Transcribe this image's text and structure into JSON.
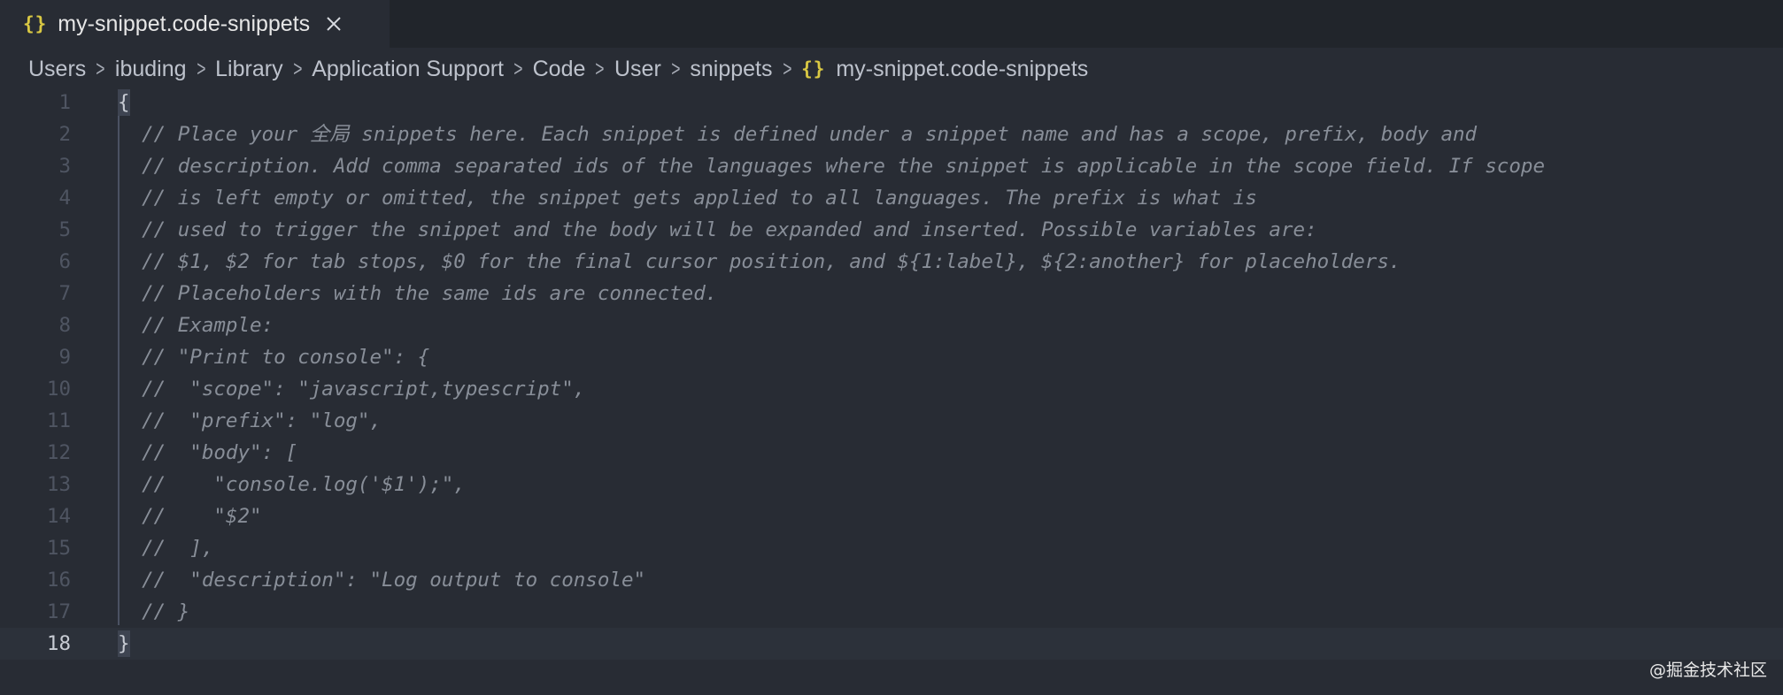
{
  "tab": {
    "icon": "json-braces-icon",
    "icon_text": "{}",
    "title": "my-snippet.code-snippets",
    "close_icon": "close-icon"
  },
  "breadcrumb": {
    "items": [
      "Users",
      "ibuding",
      "Library",
      "Application Support",
      "Code",
      "User",
      "snippets"
    ],
    "separator_glyph": ">",
    "file_icon_text": "{}",
    "file": "my-snippet.code-snippets"
  },
  "editor": {
    "lines": [
      {
        "n": "1",
        "text": "{"
      },
      {
        "n": "2",
        "text": "// Place your 全局 snippets here. Each snippet is defined under a snippet name and has a scope, prefix, body and"
      },
      {
        "n": "3",
        "text": "// description. Add comma separated ids of the languages where the snippet is applicable in the scope field. If scope"
      },
      {
        "n": "4",
        "text": "// is left empty or omitted, the snippet gets applied to all languages. The prefix is what is"
      },
      {
        "n": "5",
        "text": "// used to trigger the snippet and the body will be expanded and inserted. Possible variables are:"
      },
      {
        "n": "6",
        "text": "// $1, $2 for tab stops, $0 for the final cursor position, and ${1:label}, ${2:another} for placeholders."
      },
      {
        "n": "7",
        "text": "// Placeholders with the same ids are connected."
      },
      {
        "n": "8",
        "text": "// Example:"
      },
      {
        "n": "9",
        "text": "// \"Print to console\": {"
      },
      {
        "n": "10",
        "text": "//  \"scope\": \"javascript,typescript\","
      },
      {
        "n": "11",
        "text": "//  \"prefix\": \"log\","
      },
      {
        "n": "12",
        "text": "//  \"body\": ["
      },
      {
        "n": "13",
        "text": "//    \"console.log('$1');\","
      },
      {
        "n": "14",
        "text": "//    \"$2\""
      },
      {
        "n": "15",
        "text": "//  ],"
      },
      {
        "n": "16",
        "text": "//  \"description\": \"Log output to console\""
      },
      {
        "n": "17",
        "text": "// }"
      },
      {
        "n": "18",
        "text": "}"
      }
    ],
    "current_line": "18"
  },
  "watermark": "@掘金技术社区",
  "colors": {
    "background": "#282c34",
    "tabbar": "#21252b",
    "comment": "#888e98",
    "braces_icon": "#d9c843",
    "line_number": "#4f5562"
  }
}
